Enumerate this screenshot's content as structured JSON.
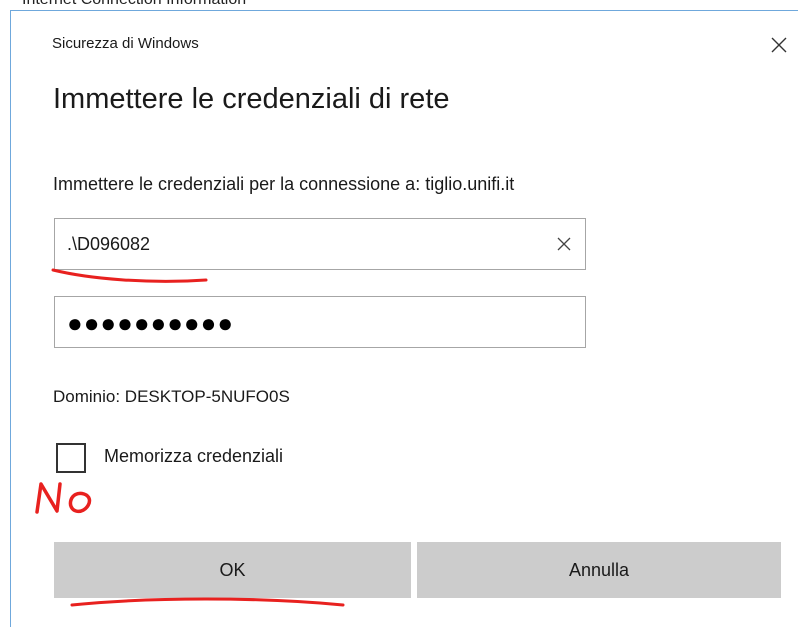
{
  "window": {
    "title": "Sicurezza di Windows",
    "close_glyph": "✕"
  },
  "dialog": {
    "heading": "Immettere le credenziali di rete",
    "connection_text": "Immettere le credenziali per la connessione a: tiglio.unifi.it",
    "username_value": ".\\D096082",
    "clear_glyph": "✕",
    "password_dots": "●●●●●●●●●●",
    "domain_text": "Dominio: DESKTOP-5NUFO0S",
    "remember_label": "Memorizza credenziali",
    "remember_checked": false
  },
  "buttons": {
    "ok_label": "OK",
    "cancel_label": "Annulla"
  },
  "annotations": {
    "handwritten_note": "NO",
    "ink_color": "#e8211f"
  },
  "colors": {
    "button_bg": "#cccccc",
    "border": "#a6a6a6",
    "window_border": "#6fa8dc"
  }
}
